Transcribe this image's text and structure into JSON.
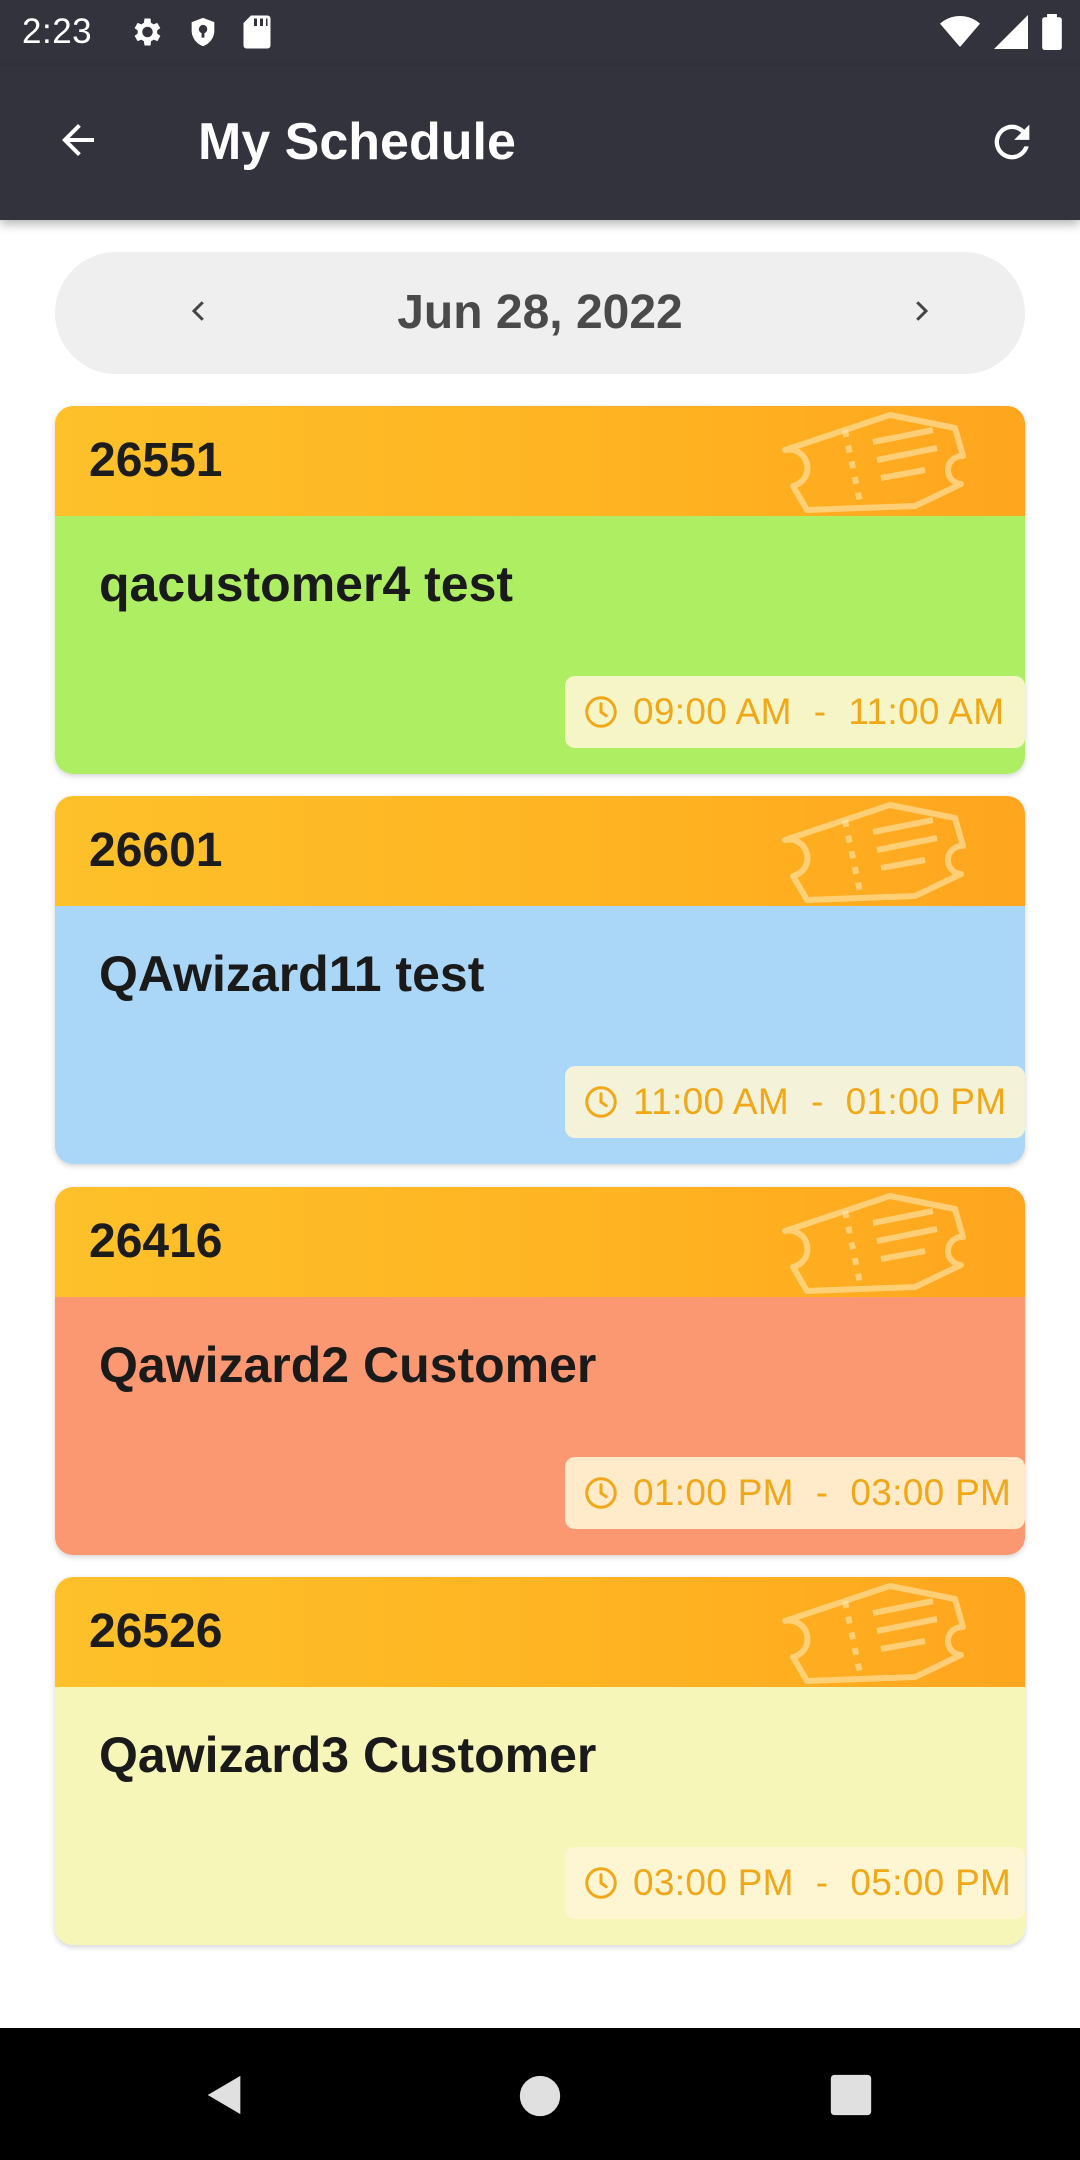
{
  "status_bar": {
    "time": "2:23",
    "left_icons": [
      "gear-icon",
      "shield-icon",
      "sd-card-icon"
    ],
    "right_icons": [
      "wifi-icon",
      "signal-icon",
      "battery-icon"
    ]
  },
  "app_bar": {
    "title": "My Schedule",
    "back_icon": "arrow-left-icon",
    "refresh_icon": "refresh-icon"
  },
  "date_nav": {
    "date": "Jun 28, 2022",
    "prev_icon": "chevron-left-icon",
    "next_icon": "chevron-right-icon"
  },
  "colors": {
    "app_bar": "#33333d",
    "header_gradient_start": "#fec12a",
    "header_gradient_end": "#ffa51f",
    "time_text": "#f0a818"
  },
  "appointments": [
    {
      "id": "26551",
      "name": "qacustomer4 test",
      "start": "09:00 AM",
      "end": "11:00 AM",
      "color": "#aeee63"
    },
    {
      "id": "26601",
      "name": "QAwizard11 test",
      "start": "11:00 AM",
      "end": "01:00 PM",
      "color": "#aad6f7"
    },
    {
      "id": "26416",
      "name": "Qawizard2 Customer",
      "start": "01:00 PM",
      "end": "03:00 PM",
      "color": "#fb9771"
    },
    {
      "id": "26526",
      "name": "Qawizard3 Customer",
      "start": "03:00 PM",
      "end": "05:00 PM",
      "color": "#f5f6b8"
    }
  ],
  "time_separator": "-",
  "nav_bar": {
    "icons": [
      "nav-back-icon",
      "nav-home-icon",
      "nav-recents-icon"
    ]
  }
}
